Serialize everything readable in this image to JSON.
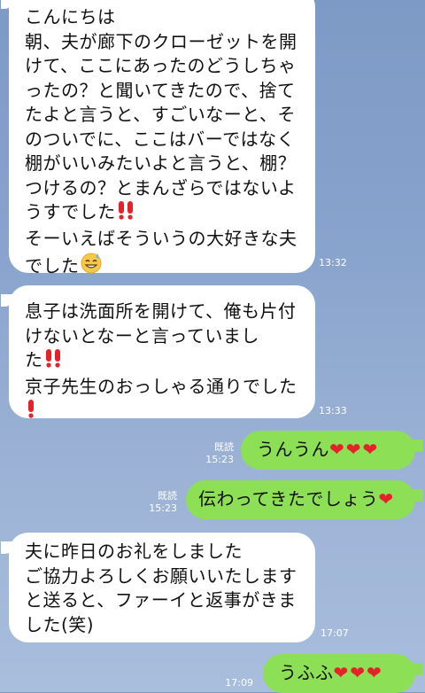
{
  "messages": [
    {
      "type": "incoming",
      "lines": [
        "こんにちは",
        "朝、夫が廊下のクローゼットを開",
        "けて、ここにあったのどうしちゃ",
        "ったの？と聞いてきたので、捨て",
        "たよと言うと、すごいなーと、そ",
        "のついでに、ここはバーではなく",
        "棚がいいみたいよと言うと、棚？",
        "つけるの？とまんざらではないよ",
        "うすでした",
        "そーいえばそういうの大好きな夫",
        "でした"
      ],
      "time": "13:32"
    },
    {
      "type": "incoming",
      "lines": [
        "息子は洗面所を開けて、俺も片付",
        "けないとなーと言っていまし",
        "た",
        "京子先生のおっしゃる通りでした"
      ],
      "time": "13:33"
    },
    {
      "type": "outgoing",
      "text": "うんうん",
      "read_label": "既読",
      "time": "15:23"
    },
    {
      "type": "outgoing",
      "text": "伝わってきたでしょう",
      "read_label": "既読",
      "time": "15:23"
    },
    {
      "type": "incoming",
      "lines": [
        "夫に昨日のお礼をしました",
        "ご協力よろしくお願いいたします",
        "と送ると、ファーイと返事がきま",
        "した(笑)"
      ],
      "time": "17:07"
    },
    {
      "type": "outgoing",
      "text": "うふふ",
      "time": "17:09"
    }
  ],
  "icons": {
    "double_exclamation": "double-exclamation-icon",
    "exclamation": "exclamation-icon",
    "sweat_smile": "sweat-smile-emoji",
    "heart": "red-heart-emoji"
  },
  "colors": {
    "background": "#88a3cc",
    "incoming_bubble": "#ffffff",
    "outgoing_bubble": "#8de055",
    "emoji_red": "#e5212a"
  }
}
